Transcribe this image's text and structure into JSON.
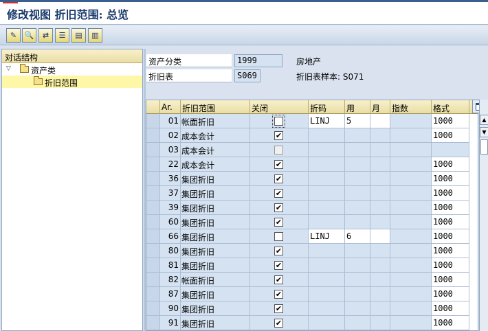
{
  "window": {
    "title": "修改视图 折旧范围: 总览"
  },
  "toolbar": {
    "buttons": [
      {
        "name": "edit-pencil-icon",
        "glyph": "✎"
      },
      {
        "name": "search-icon",
        "glyph": "🔍"
      },
      {
        "name": "compare-icon",
        "glyph": "⇄"
      },
      {
        "name": "select-all-icon",
        "glyph": "☰"
      },
      {
        "name": "select-block-icon",
        "glyph": "▤"
      },
      {
        "name": "deselect-icon",
        "glyph": "▥"
      }
    ]
  },
  "tree": {
    "header": "对话结构",
    "items": [
      {
        "label": "资产类",
        "level": 0,
        "expanded": true,
        "selected": false
      },
      {
        "label": "折旧范围",
        "level": 1,
        "expanded": false,
        "selected": true
      }
    ]
  },
  "header_fields": {
    "asset_class": {
      "label": "资产分类",
      "value": "1999",
      "desc": "房地产"
    },
    "dep_key": {
      "label": "折旧表",
      "value": "S069",
      "desc": "折旧表样本: S071"
    }
  },
  "table": {
    "columns": [
      "Ar.",
      "折旧范围",
      "关闭",
      "折码",
      "用",
      "月",
      "指数",
      "格式"
    ],
    "rows": [
      {
        "ar": "01",
        "name": "帐面折旧",
        "closed": false,
        "code": "LINJ",
        "use": "5",
        "month": "",
        "index": "",
        "fmt": "1000",
        "editable": true,
        "focus": true
      },
      {
        "ar": "02",
        "name": "成本会计",
        "closed": true,
        "code": "",
        "use": "",
        "month": "",
        "index": "",
        "fmt": "1000",
        "editable": false,
        "focus": false
      },
      {
        "ar": "03",
        "name": "成本会计",
        "closed": false,
        "code": "",
        "use": "",
        "month": "",
        "index": "",
        "fmt": "",
        "editable": false,
        "disabled": true,
        "focus": false
      },
      {
        "ar": "22",
        "name": "成本会计",
        "closed": true,
        "code": "",
        "use": "",
        "month": "",
        "index": "",
        "fmt": "1000",
        "editable": false,
        "focus": false
      },
      {
        "ar": "36",
        "name": "集团折旧",
        "closed": true,
        "code": "",
        "use": "",
        "month": "",
        "index": "",
        "fmt": "1000",
        "editable": false,
        "focus": false
      },
      {
        "ar": "37",
        "name": "集团折旧",
        "closed": true,
        "code": "",
        "use": "",
        "month": "",
        "index": "",
        "fmt": "1000",
        "editable": false,
        "focus": false
      },
      {
        "ar": "39",
        "name": "集团折旧",
        "closed": true,
        "code": "",
        "use": "",
        "month": "",
        "index": "",
        "fmt": "1000",
        "editable": false,
        "focus": false
      },
      {
        "ar": "60",
        "name": "集团折旧",
        "closed": true,
        "code": "",
        "use": "",
        "month": "",
        "index": "",
        "fmt": "1000",
        "editable": false,
        "focus": false
      },
      {
        "ar": "66",
        "name": "集团折旧",
        "closed": false,
        "code": "LINJ",
        "use": "6",
        "month": "",
        "index": "",
        "fmt": "1000",
        "editable": true,
        "focus": false
      },
      {
        "ar": "80",
        "name": "集团折旧",
        "closed": true,
        "code": "",
        "use": "",
        "month": "",
        "index": "",
        "fmt": "1000",
        "editable": false,
        "focus": false
      },
      {
        "ar": "81",
        "name": "集团折旧",
        "closed": true,
        "code": "",
        "use": "",
        "month": "",
        "index": "",
        "fmt": "1000",
        "editable": false,
        "focus": false
      },
      {
        "ar": "82",
        "name": "帐面折旧",
        "closed": true,
        "code": "",
        "use": "",
        "month": "",
        "index": "",
        "fmt": "1000",
        "editable": false,
        "focus": false
      },
      {
        "ar": "87",
        "name": "集团折旧",
        "closed": true,
        "code": "",
        "use": "",
        "month": "",
        "index": "",
        "fmt": "1000",
        "editable": false,
        "focus": false
      },
      {
        "ar": "90",
        "name": "集团折旧",
        "closed": true,
        "code": "",
        "use": "",
        "month": "",
        "index": "",
        "fmt": "1000",
        "editable": false,
        "focus": false
      },
      {
        "ar": "91",
        "name": "集团折旧",
        "closed": true,
        "code": "",
        "use": "",
        "month": "",
        "index": "",
        "fmt": "1000",
        "editable": false,
        "focus": false
      }
    ]
  },
  "scrollbar": {
    "up_glyph": "▲",
    "down_glyph": "▼"
  }
}
